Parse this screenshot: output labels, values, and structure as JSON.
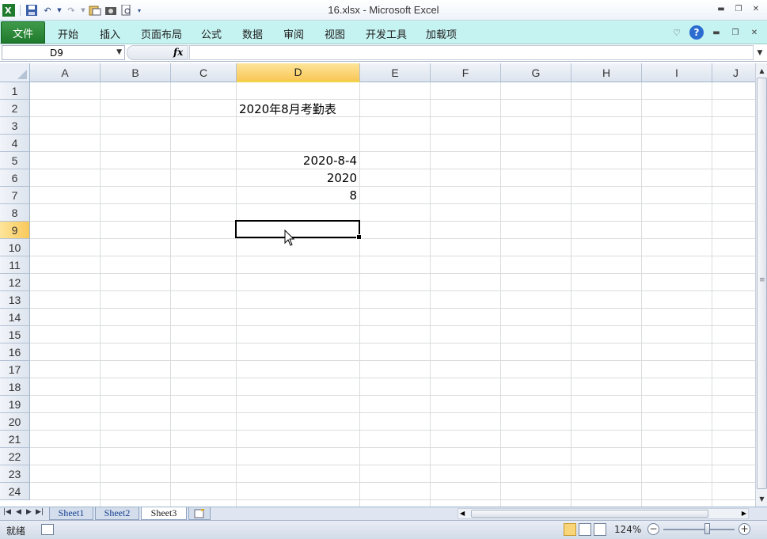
{
  "window": {
    "title": "16.xlsx  -  Microsoft Excel"
  },
  "ribbon": {
    "file_tab": "文件",
    "tabs": [
      "开始",
      "插入",
      "页面布局",
      "公式",
      "数据",
      "审阅",
      "视图",
      "开发工具",
      "加载项"
    ]
  },
  "formula_bar": {
    "name_box": "D9",
    "fx_label": "fx",
    "formula": ""
  },
  "grid": {
    "columns": [
      "A",
      "B",
      "C",
      "D",
      "E",
      "F",
      "G",
      "H",
      "I",
      "J"
    ],
    "rows": [
      "1",
      "2",
      "3",
      "4",
      "5",
      "6",
      "7",
      "8",
      "9",
      "10",
      "11",
      "12",
      "13",
      "14",
      "15",
      "16",
      "17",
      "18",
      "19",
      "20",
      "21",
      "22",
      "23",
      "24"
    ],
    "selected_column": "D",
    "selected_row": "9",
    "cells": {
      "D2": "2020年8月考勤表",
      "D5": "2020-8-4",
      "D6": "2020",
      "D7": "8"
    }
  },
  "sheets": {
    "tabs": [
      "Sheet1",
      "Sheet2",
      "Sheet3"
    ],
    "active": "Sheet3"
  },
  "status": {
    "ready_text": "就绪",
    "zoom": "124%",
    "zoom_level": 0.62
  }
}
